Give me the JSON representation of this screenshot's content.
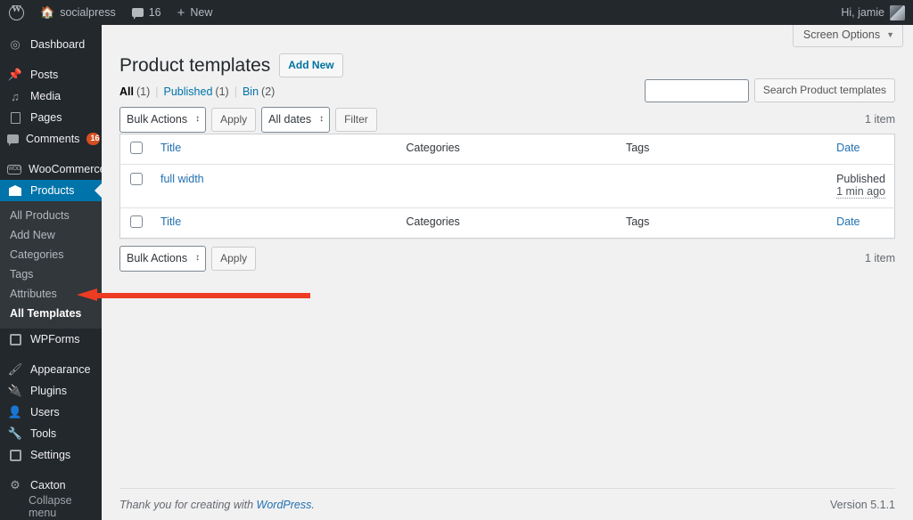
{
  "colors": {
    "admin_bar_bg": "#23282d",
    "sidebar_bg": "#23282d",
    "submenu_bg": "#32373c",
    "active_blue": "#0073aa",
    "link_blue": "#2271b1",
    "badge_orange": "#d54e21",
    "arrow_red": "#ee3b24",
    "page_bg": "#f1f1f1"
  },
  "adminbar": {
    "logo_icon": "wordpress-logo-icon",
    "site_icon": "home-icon",
    "site_name": "socialpress",
    "comments_icon": "comment-bubble-icon",
    "comments_count": "16",
    "new_icon": "plus-icon",
    "new_label": "New",
    "greeting": "Hi, jamie",
    "avatar_icon": "user-avatar"
  },
  "sidebar": {
    "items": [
      {
        "label": "Dashboard",
        "icon": "dashboard-icon",
        "active": false
      },
      {
        "label": "Posts",
        "icon": "pin-icon",
        "active": false
      },
      {
        "label": "Media",
        "icon": "media-icon",
        "active": false
      },
      {
        "label": "Pages",
        "icon": "page-icon",
        "active": false
      },
      {
        "label": "Comments",
        "icon": "comment-bubble-icon",
        "active": false,
        "badge": "16"
      },
      {
        "label": "WooCommerce",
        "icon": "woocommerce-icon",
        "active": false
      },
      {
        "label": "Products",
        "icon": "products-box-icon",
        "active": true
      }
    ],
    "submenu": [
      {
        "label": "All Products",
        "current": false
      },
      {
        "label": "Add New",
        "current": false
      },
      {
        "label": "Categories",
        "current": false
      },
      {
        "label": "Tags",
        "current": false
      },
      {
        "label": "Attributes",
        "current": false
      },
      {
        "label": "All Templates",
        "current": true
      }
    ],
    "items_after": [
      {
        "label": "WPForms",
        "icon": "wpforms-icon"
      },
      {
        "label": "Appearance",
        "icon": "appearance-brush-icon"
      },
      {
        "label": "Plugins",
        "icon": "plugins-plug-icon"
      },
      {
        "label": "Users",
        "icon": "users-icon"
      },
      {
        "label": "Tools",
        "icon": "tools-wrench-icon"
      },
      {
        "label": "Settings",
        "icon": "settings-sliders-icon"
      }
    ],
    "items_tail": [
      {
        "label": "Caxton",
        "icon": "gear-icon"
      }
    ],
    "collapse": {
      "label": "Collapse menu",
      "icon": "collapse-arrow-icon"
    }
  },
  "screen_options": {
    "label": "Screen Options",
    "caret_icon": "chevron-down-icon"
  },
  "page": {
    "title": "Product templates",
    "add_new_label": "Add New"
  },
  "filters": {
    "all": {
      "label": "All",
      "count": "(1)"
    },
    "published": {
      "label": "Published",
      "count": "(1)"
    },
    "bin": {
      "label": "Bin",
      "count": "(2)"
    },
    "divider": "|"
  },
  "search": {
    "value": "",
    "placeholder": "",
    "button_label": "Search Product templates"
  },
  "toolbar_top": {
    "bulk_actions_label": "Bulk Actions",
    "apply_label": "Apply",
    "dates_label": "All dates",
    "filter_label": "Filter",
    "item_count": "1 item"
  },
  "toolbar_bottom": {
    "bulk_actions_label": "Bulk Actions",
    "apply_label": "Apply",
    "item_count": "1 item"
  },
  "table": {
    "columns": {
      "title": "Title",
      "categories": "Categories",
      "tags": "Tags",
      "date": "Date"
    },
    "rows": [
      {
        "title": "full width",
        "categories": "",
        "tags": "",
        "date_status": "Published",
        "date_relative": "1 min ago"
      }
    ]
  },
  "footer": {
    "thanks_prefix": "Thank you for creating with ",
    "thanks_link": "WordPress",
    "thanks_suffix": ".",
    "version": "Version 5.1.1"
  },
  "annotation": {
    "arrow_icon": "left-arrow-annotation",
    "points_at": "All Templates"
  }
}
